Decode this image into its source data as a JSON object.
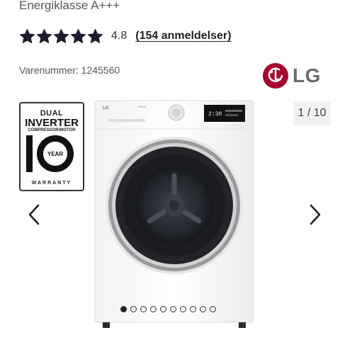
{
  "product": {
    "energy_class": "Energiklasse A+++",
    "rating_score": "4.8",
    "reviews_link": "(154 anmeldelser)",
    "sku": "Varenummer: 1245560",
    "brand": "LG"
  },
  "rating": {
    "value": 4.8,
    "max": 5
  },
  "gallery": {
    "counter": "1 / 10",
    "active_index": 1,
    "total": 10
  },
  "badge": {
    "line1": "DUAL",
    "line2": "INVERTER",
    "line3": "COMPRESSOR/MOTOR",
    "year": "YEAR",
    "line4": "WARRANTY"
  },
  "appliance": {
    "brand_mark": "LG",
    "model_mark": "ThinQ",
    "display_time": "2:30"
  },
  "colors": {
    "lg_red": "#a50034",
    "star": "#1c1c2e",
    "text": "#222222"
  },
  "icons": {
    "prev": "chevron-left-icon",
    "next": "chevron-right-icon",
    "star": "star-icon"
  }
}
